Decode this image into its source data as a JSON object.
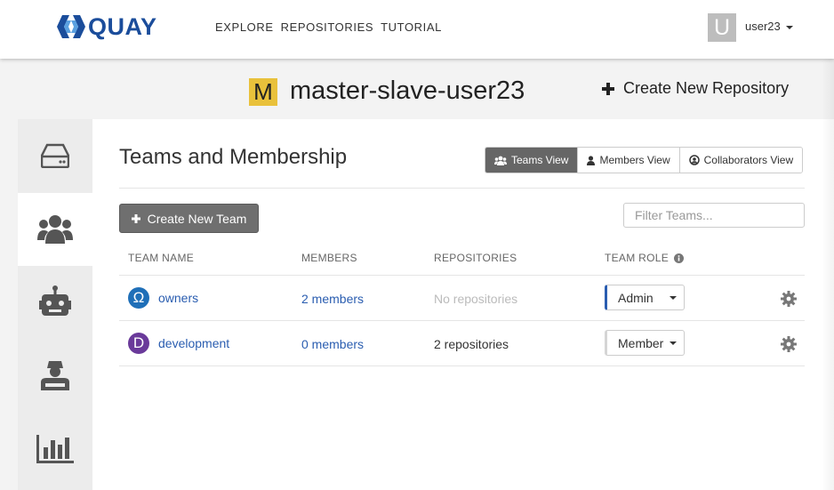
{
  "app": {
    "logo_text": "QUAY"
  },
  "nav": {
    "items": [
      "EXPLORE",
      "REPOSITORIES",
      "TUTORIAL"
    ]
  },
  "user": {
    "avatar_letter": "U",
    "name": "user23"
  },
  "namespace": {
    "avatar_letter": "M",
    "title": "master-slave-user23",
    "create_repo_label": "Create New Repository"
  },
  "section": {
    "title": "Teams and Membership"
  },
  "views": {
    "teams": "Teams View",
    "members": "Members View",
    "collaborators": "Collaborators View",
    "active": "teams"
  },
  "toolbar": {
    "create_team_label": "Create New Team",
    "filter_placeholder": "Filter Teams..."
  },
  "table": {
    "headers": {
      "team_name": "TEAM NAME",
      "members": "MEMBERS",
      "repositories": "REPOSITORIES",
      "team_role": "TEAM ROLE"
    },
    "rows": [
      {
        "avatar_letter": "Ω",
        "avatar_color": "#1f6fb8",
        "name": "owners",
        "members": "2 members",
        "repositories": "No repositories",
        "role": "Admin"
      },
      {
        "avatar_letter": "D",
        "avatar_color": "#6a3a9a",
        "name": "development",
        "members": "0 members",
        "repositories": "2 repositories",
        "role": "Member"
      }
    ]
  },
  "sidebar": {
    "tabs": [
      "repositories-icon",
      "teams-icon",
      "robot-icon",
      "user-settings-icon",
      "usage-chart-icon"
    ],
    "active": "teams-icon"
  },
  "colors": {
    "brand": "#1b4d9b",
    "link": "#2a5db0",
    "namespace_avatar": "#e9c13b",
    "active_view": "#666666"
  }
}
